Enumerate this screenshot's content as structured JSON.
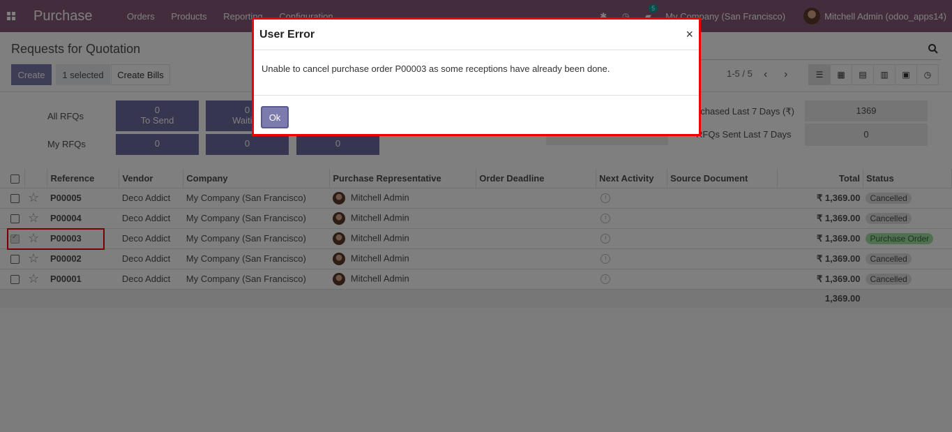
{
  "navbar": {
    "app_name": "Purchase",
    "menu": [
      "Orders",
      "Products",
      "Reporting",
      "Configuration"
    ],
    "chat_badge": "5",
    "company": "My Company (San Francisco)",
    "user": "Mitchell Admin (odoo_apps14)"
  },
  "control": {
    "title": "Requests for Quotation",
    "create_label": "Create",
    "selected_label": "1 selected",
    "create_bills_label": "Create Bills",
    "pager": "1-5 / 5"
  },
  "dashboard": {
    "all_rfqs_label": "All RFQs",
    "my_rfqs_label": "My RFQs",
    "tiles_row1": [
      {
        "value": "0",
        "label": "To Send"
      },
      {
        "value": "0",
        "label": "Waiting"
      },
      {
        "value": "",
        "label": ""
      }
    ],
    "tiles_row2": [
      "0",
      "0",
      "0"
    ],
    "stats": [
      {
        "label": "Purchased Last 7 Days (₹)",
        "value": "1369"
      },
      {
        "label": "RFQs Sent Last 7 Days",
        "value": "0"
      }
    ]
  },
  "table": {
    "headers": [
      "Reference",
      "Vendor",
      "Company",
      "Purchase Representative",
      "Order Deadline",
      "Next Activity",
      "Source Document",
      "Total",
      "Status"
    ],
    "rows": [
      {
        "ref": "P00005",
        "vendor": "Deco Addict",
        "company": "My Company (San Francisco)",
        "rep": "Mitchell Admin",
        "total": "₹ 1,369.00",
        "status": "Cancelled"
      },
      {
        "ref": "P00004",
        "vendor": "Deco Addict",
        "company": "My Company (San Francisco)",
        "rep": "Mitchell Admin",
        "total": "₹ 1,369.00",
        "status": "Cancelled"
      },
      {
        "ref": "P00003",
        "vendor": "Deco Addict",
        "company": "My Company (San Francisco)",
        "rep": "Mitchell Admin",
        "total": "₹ 1,369.00",
        "status": "Purchase Order"
      },
      {
        "ref": "P00002",
        "vendor": "Deco Addict",
        "company": "My Company (San Francisco)",
        "rep": "Mitchell Admin",
        "total": "₹ 1,369.00",
        "status": "Cancelled"
      },
      {
        "ref": "P00001",
        "vendor": "Deco Addict",
        "company": "My Company (San Francisco)",
        "rep": "Mitchell Admin",
        "total": "₹ 1,369.00",
        "status": "Cancelled"
      }
    ],
    "grand_total": "1,369.00"
  },
  "modal": {
    "title": "User Error",
    "close": "×",
    "message": "Unable to cancel purchase order P00003 as some receptions have already been done.",
    "ok_label": "Ok"
  }
}
